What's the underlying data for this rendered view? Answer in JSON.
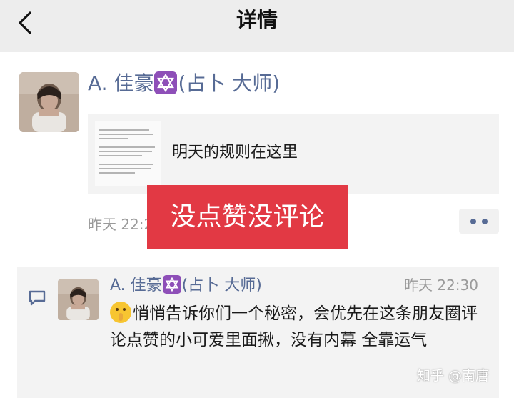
{
  "header": {
    "title": "详情"
  },
  "post": {
    "author": "A. 佳豪",
    "author_suffix": "(占卜 大师)",
    "link_card": {
      "text": "明天的规则在这里"
    },
    "time": "昨天 22:2"
  },
  "overlay": {
    "text": "没点赞没评论"
  },
  "comment": {
    "author": "A. 佳豪",
    "author_suffix": "(占卜 大师)",
    "time": "昨天 22:30",
    "text": "悄悄告诉你们一个秘密，会优先在这条朋友圈评论点赞的小可爱里面揪，没有内幕 全靠运气"
  },
  "watermark": "知乎 @南唐",
  "icons": {
    "back": "chevron-left-icon",
    "star": "six-pointed-star-icon",
    "more": "more-dots-icon",
    "comment": "comment-bubble-icon",
    "emoji": "shushing-face-emoji-icon"
  },
  "colors": {
    "name_link": "#576b95",
    "banner": "#e23944",
    "topbar": "#ededed",
    "panel": "#f3f3f3"
  }
}
